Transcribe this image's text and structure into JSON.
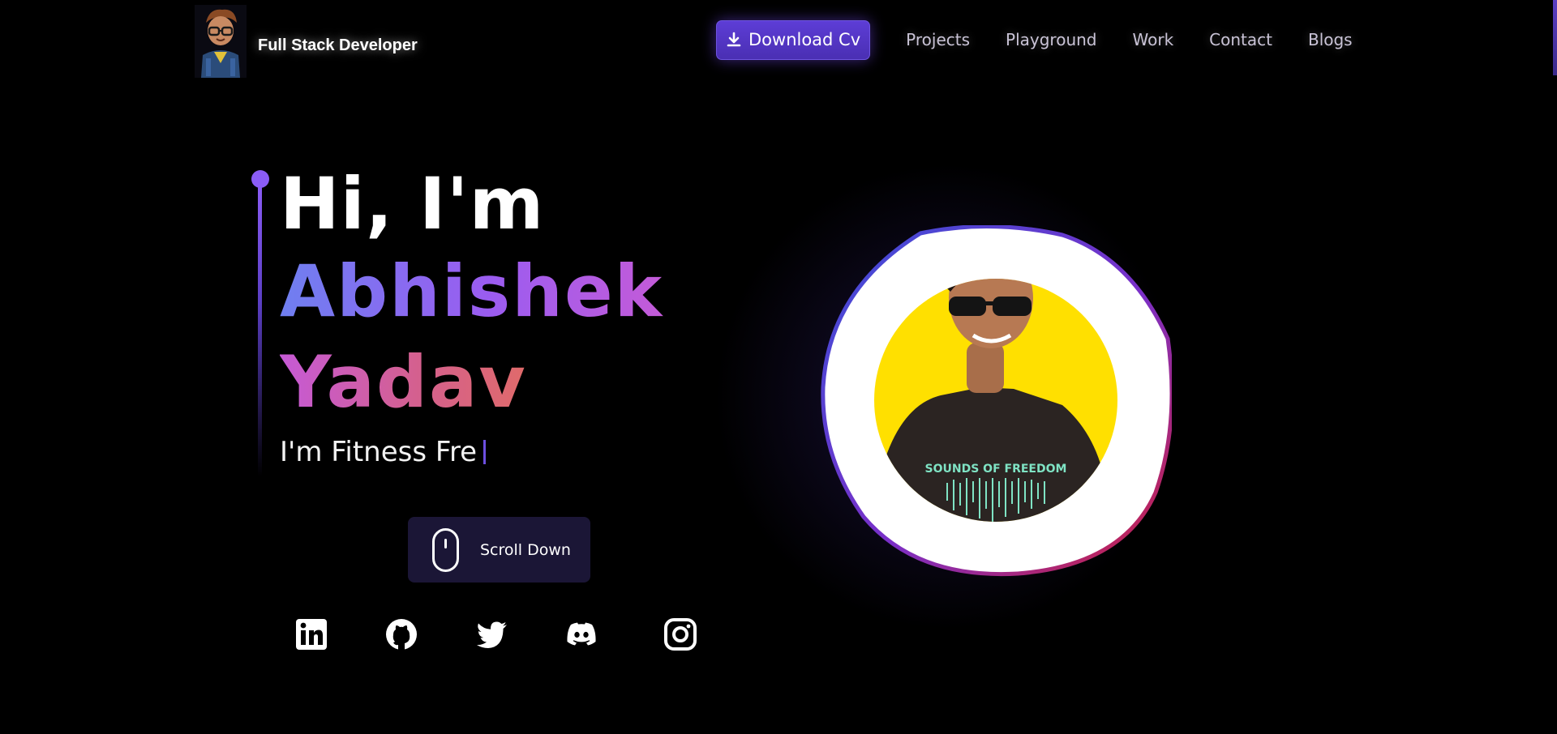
{
  "nav": {
    "brand_name": "Full Stack Developer",
    "cv_button_label": "Download Cv",
    "links": [
      "Projects",
      "Playground",
      "Work",
      "Contact",
      "Blogs"
    ]
  },
  "hero": {
    "greeting": "Hi, I'm",
    "first_name": "Abhishek",
    "last_name": "Yadav",
    "typed_text": "I'm Fitness Fre"
  },
  "scroll": {
    "label": "Scroll Down"
  },
  "socials": [
    "linkedin-icon",
    "github-icon",
    "twitter-icon",
    "discord-icon",
    "instagram-icon"
  ],
  "colors": {
    "background": "#000000",
    "accent": "#5d3dd6",
    "name_gradient_start": "#6f7ff0",
    "name_gradient_end": "#e06a6a",
    "portrait_ring_start": "#3b4fd8",
    "portrait_ring_end": "#d0203a",
    "portrait_backdrop": "#ffe000"
  }
}
